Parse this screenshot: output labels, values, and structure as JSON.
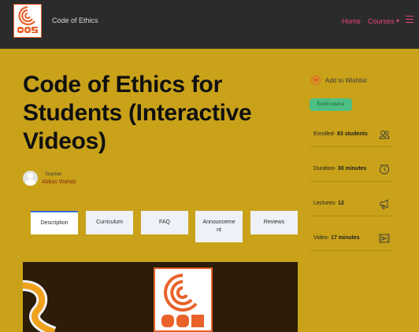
{
  "header": {
    "site_title": "Code of Ethics",
    "nav": {
      "home": "Home",
      "courses": "Courses"
    }
  },
  "course": {
    "title": "Code of Ethics for Students (Interactive Videos)",
    "teacher_label": "Teacher",
    "teacher_name": "Abbas Wahab"
  },
  "tabs": [
    {
      "label": "Description",
      "active": true
    },
    {
      "label": "Curriculum"
    },
    {
      "label": "FAQ"
    },
    {
      "label": "Announceme nt"
    },
    {
      "label": "Reviews"
    }
  ],
  "sidebar": {
    "wishlist": "Add to Wishlist",
    "enroll": "Enroll course",
    "meta": [
      {
        "label": "Enrolled",
        "value": "83 students",
        "icon": "users-icon"
      },
      {
        "label": "Duration",
        "value": "30 minutes",
        "icon": "clock-icon"
      },
      {
        "label": "Lectures",
        "value": "12",
        "icon": "megaphone-icon"
      },
      {
        "label": "Video",
        "value": "17 minutes",
        "icon": "video-icon"
      }
    ]
  },
  "colors": {
    "page_bg": "#C9A21A",
    "header_bg": "#2B2B2B",
    "accent": "#E8427A",
    "brand_orange": "#E8622A",
    "enroll_green": "#4DBE84"
  }
}
